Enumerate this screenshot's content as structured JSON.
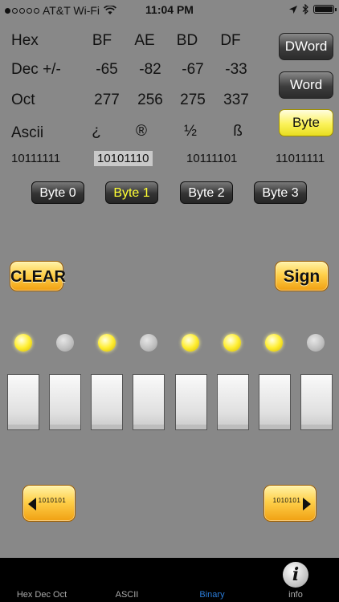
{
  "status": {
    "carrier": "AT&T Wi-Fi",
    "time": "11:04 PM"
  },
  "labels": {
    "hex": "Hex",
    "dec": "Dec +/-",
    "oct": "Oct",
    "ascii": "Ascii"
  },
  "columns": [
    {
      "hex": "BF",
      "dec": "-65",
      "oct": "277",
      "ascii": "¿",
      "binary": "10111111"
    },
    {
      "hex": "AE",
      "dec": "-82",
      "oct": "256",
      "ascii": "®",
      "binary": "10101110"
    },
    {
      "hex": "BD",
      "dec": "-67",
      "oct": "275",
      "ascii": "½",
      "binary": "10111101"
    },
    {
      "hex": "DF",
      "dec": "-33",
      "oct": "337",
      "ascii": "ß",
      "binary": "11011111"
    }
  ],
  "modes": {
    "dword": "DWord",
    "word": "Word",
    "byte": "Byte",
    "selected": "Byte"
  },
  "byte_tabs": [
    "Byte 0",
    "Byte 1",
    "Byte 2",
    "Byte 3"
  ],
  "selected_byte_tab": "Byte 1",
  "actions": {
    "clear": "CLEAR",
    "sign": "Sign",
    "shift_left_bits": "1010101",
    "shift_right_bits": "1010101"
  },
  "leds": [
    true,
    false,
    true,
    false,
    true,
    true,
    true,
    false
  ],
  "tabbar": {
    "tabs": [
      "Hex Dec Oct",
      "ASCII",
      "Binary",
      "info"
    ],
    "active": "Binary",
    "info_glyph": "i"
  },
  "colors": {
    "background": "#888888",
    "led_on": "#ffee33",
    "active_tab": "#2a7bd8",
    "active_byte_text": "#ffff33"
  }
}
